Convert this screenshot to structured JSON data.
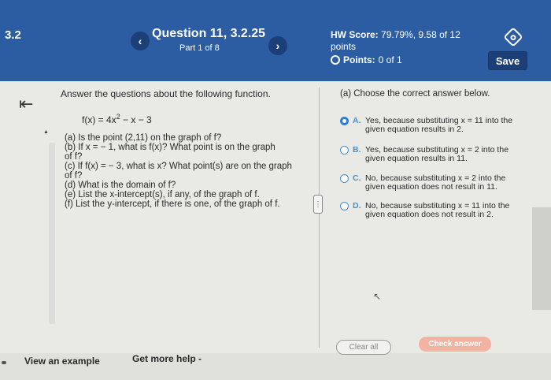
{
  "header": {
    "section": "3.2",
    "question_title": "Question 11, 3.2.25",
    "part": "Part 1 of 8",
    "hw_label": "HW Score:",
    "hw_value": "79.79%, 9.58 of 12",
    "hw_points_word": "points",
    "points_label": "Points:",
    "points_value": "0 of 1",
    "save_label": "Save",
    "prev_icon": "‹",
    "next_icon": "›"
  },
  "question": {
    "instructions": "Answer the questions about the following function.",
    "function_left": "f(x) = 4x",
    "function_exp": "2",
    "function_right": " − x − 3",
    "parts": [
      "(a) Is the point (2,11) on the graph of f?",
      "(b) If x = − 1, what is f(x)? What point is on the graph",
      "of f?",
      "(c) If f(x) = − 3, what is x? What point(s) are on the graph",
      "of f?",
      "(d) What is the domain of f?",
      "(e) List the x-intercept(s), if any, of the graph of f.",
      "(f) List the y-intercept, if there is one, of the graph of f."
    ]
  },
  "answer": {
    "prompt": "(a) Choose the correct answer below.",
    "options": [
      {
        "letter": "A.",
        "line1": "Yes, because substituting x = 11 into the",
        "line2": "given equation results in 2.",
        "selected": true
      },
      {
        "letter": "B.",
        "line1": "Yes, because substituting x = 2 into the",
        "line2": "given equation results in 11.",
        "selected": false
      },
      {
        "letter": "C.",
        "line1": "No, because substituting x = 2 into the",
        "line2": "given equation does not result in 11.",
        "selected": false
      },
      {
        "letter": "D.",
        "line1": "No, because substituting x = 11 into the",
        "line2": "given equation does not result in 2.",
        "selected": false
      }
    ]
  },
  "footer": {
    "clear_all": "Clear all",
    "check_answer": "Check answer",
    "view_example": "View an example",
    "get_help": "Get more help -"
  },
  "colors": {
    "header_bg": "#2c5da3",
    "accent": "#2f80d0",
    "check_button": "#f2b3a2"
  },
  "icons": {
    "collapse": "collapse-left-icon",
    "settings": "settings-icon",
    "cursor": "mouse-cursor-icon"
  }
}
